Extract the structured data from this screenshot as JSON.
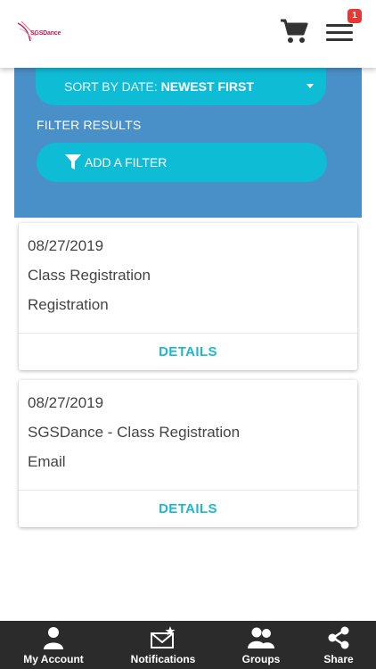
{
  "header": {
    "logo_text": "SGSDance",
    "cart_icon": "cart-icon",
    "menu_icon": "menu-icon",
    "badge_count": "1"
  },
  "filters": {
    "sort_prefix": "SORT BY DATE:",
    "sort_value": "NEWEST FIRST",
    "filter_label": "FILTER RESULTS",
    "add_filter_label": "ADD A FILTER"
  },
  "cards": [
    {
      "date": "08/27/2019",
      "title": "Class Registration",
      "type": "Registration",
      "action": "DETAILS"
    },
    {
      "date": "08/27/2019",
      "title": "SGSDance - Class Registration",
      "type": "Email",
      "action": "DETAILS"
    }
  ],
  "bottom_nav": [
    {
      "label": "My Account",
      "icon": "user-icon"
    },
    {
      "label": "Notifications",
      "icon": "envelope-star-icon"
    },
    {
      "label": "Groups",
      "icon": "group-icon"
    },
    {
      "label": "Share",
      "icon": "share-icon"
    }
  ],
  "colors": {
    "panel": "#4a90c8",
    "pill": "#0fbcd6",
    "accent_text": "#1fb6cf",
    "nav_bg": "#2b2b2b",
    "badge": "#e53935"
  }
}
